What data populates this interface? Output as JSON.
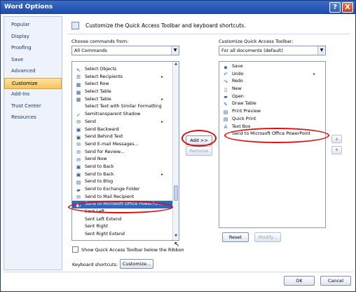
{
  "window": {
    "title": "Word Options"
  },
  "titlebar": {
    "help": "?",
    "close": "X"
  },
  "sidebar": {
    "items": [
      {
        "label": "Popular"
      },
      {
        "label": "Display"
      },
      {
        "label": "Proofing"
      },
      {
        "label": "Save"
      },
      {
        "label": "Advanced"
      },
      {
        "label": "Customize"
      },
      {
        "label": "Add-Ins"
      },
      {
        "label": "Trust Center"
      },
      {
        "label": "Resources"
      }
    ],
    "active": "Customize"
  },
  "header": {
    "text": "Customize the Quick Access Toolbar and keyboard shortcuts."
  },
  "left": {
    "choose_label": "Choose commands from:",
    "choose_value": "All Commands",
    "items": [
      {
        "label": "Select Objects",
        "icon": "select-objects-icon",
        "sym": "↖",
        "sub": ""
      },
      {
        "label": "Select Recipients",
        "icon": "recipients-icon",
        "sym": "☰",
        "sub": "▸"
      },
      {
        "label": "Select Row",
        "icon": "table-icon",
        "sym": "▦",
        "sub": ""
      },
      {
        "label": "Select Table",
        "icon": "table-icon",
        "sym": "▦",
        "sub": ""
      },
      {
        "label": "Select Table",
        "icon": "table-icon",
        "sym": "▦",
        "sub": "▸"
      },
      {
        "label": "Select Text with Similar Formatting",
        "icon": "",
        "sym": "",
        "sub": ""
      },
      {
        "label": "Semitransparent Shadow",
        "icon": "check-icon",
        "sym": "✓",
        "sub": ""
      },
      {
        "label": "Send",
        "icon": "send-icon",
        "sym": "✉",
        "sub": "▸"
      },
      {
        "label": "Send Backward",
        "icon": "send-backward-icon",
        "sym": "▣",
        "sub": ""
      },
      {
        "label": "Send Behind Text",
        "icon": "send-behind-icon",
        "sym": "▣",
        "sub": ""
      },
      {
        "label": "Send E-mail Messages...",
        "icon": "mail-icon",
        "sym": "✉",
        "sub": ""
      },
      {
        "label": "Send for Review...",
        "icon": "review-icon",
        "sym": "✉",
        "sub": ""
      },
      {
        "label": "Send Now",
        "icon": "send-now-icon",
        "sym": "✉",
        "sub": ""
      },
      {
        "label": "Send to Back",
        "icon": "send-back-icon",
        "sym": "▣",
        "sub": ""
      },
      {
        "label": "Send to Back",
        "icon": "send-back-icon",
        "sym": "▣",
        "sub": "▸"
      },
      {
        "label": "Send to Blog",
        "icon": "blog-icon",
        "sym": "▤",
        "sub": ""
      },
      {
        "label": "Send to Exchange Folder",
        "icon": "folder-icon",
        "sym": "▰",
        "sub": ""
      },
      {
        "label": "Send to Mail Recipient",
        "icon": "mail-icon",
        "sym": "✉",
        "sub": ""
      },
      {
        "label": "Send to Microsoft Office PowerPo...",
        "icon": "powerpoint-icon",
        "sym": "◧",
        "sub": "",
        "selected": true
      },
      {
        "label": "Sent Left",
        "icon": "",
        "sym": "",
        "sub": ""
      },
      {
        "label": "Sent Left Extend",
        "icon": "",
        "sym": "",
        "sub": ""
      },
      {
        "label": "Sent Right",
        "icon": "",
        "sym": "",
        "sub": ""
      },
      {
        "label": "Sent Right Extend",
        "icon": "",
        "sym": "",
        "sub": ""
      }
    ]
  },
  "middle": {
    "add": "Add >>",
    "remove": "Remove"
  },
  "right": {
    "customize_label": "Customize Quick Access Toolbar:",
    "customize_value": "For all documents (default)",
    "items": [
      {
        "label": "Save",
        "icon": "save-icon",
        "sym": "▪",
        "sub": ""
      },
      {
        "label": "Undo",
        "icon": "undo-icon",
        "sym": "↶",
        "sub": "▸"
      },
      {
        "label": "Redo",
        "icon": "redo-icon",
        "sym": "↷",
        "sub": ""
      },
      {
        "label": "New",
        "icon": "new-document-icon",
        "sym": "▯",
        "sub": ""
      },
      {
        "label": "Open",
        "icon": "open-folder-icon",
        "sym": "▰",
        "sub": ""
      },
      {
        "label": "Draw Table",
        "icon": "draw-table-icon",
        "sym": "✎",
        "sub": ""
      },
      {
        "label": "Print Preview",
        "icon": "print-preview-icon",
        "sym": "▤",
        "sub": ""
      },
      {
        "label": "Quick Print",
        "icon": "print-icon",
        "sym": "▤",
        "sub": ""
      },
      {
        "label": "Text Box",
        "icon": "text-box-icon",
        "sym": "A",
        "sub": ""
      },
      {
        "label": "Send to Microsoft Office PowerPoint",
        "icon": "",
        "sym": "",
        "sub": ""
      }
    ],
    "reset": "Reset",
    "modify": "Modify...",
    "up": "▲",
    "down": "▼"
  },
  "options": {
    "show_below": "Show Quick Access Toolbar below the Ribbon",
    "shortcuts_label": "Keyboard shortcuts:",
    "customize_btn": "Customize..."
  },
  "footer": {
    "ok": "OK",
    "cancel": "Cancel"
  },
  "colors": {
    "accent": "#3166c1",
    "annotation": "#d81010",
    "selected_nav": "#f7c45b"
  }
}
